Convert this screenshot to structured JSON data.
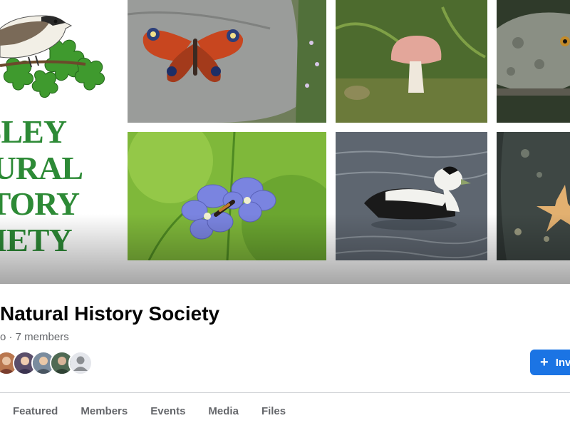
{
  "cover": {
    "logo_lines": [
      "ISLEY",
      "TURAL",
      "STORY",
      "CIETY"
    ]
  },
  "group": {
    "name": "Natural History Society",
    "meta": "o · 7 members"
  },
  "actions": {
    "invite_label": "Invi",
    "invite_icon": "plus-icon"
  },
  "tabs": [
    {
      "label": "Featured"
    },
    {
      "label": "Members"
    },
    {
      "label": "Events"
    },
    {
      "label": "Media"
    },
    {
      "label": "Files"
    }
  ],
  "colors": {
    "accent": "#1b74e4",
    "logo_green": "#2d8a36",
    "text_primary": "#050505",
    "text_secondary": "#65676b"
  }
}
